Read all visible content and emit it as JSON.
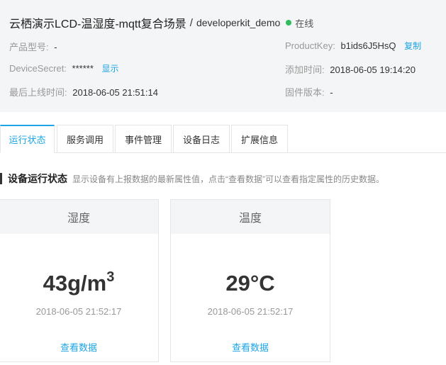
{
  "device": {
    "title": "云栖演示LCD-温湿度-mqtt复合场景",
    "separator": "/",
    "name": "developerkit_demo",
    "status": "在线",
    "status_color": "#2fbd5c"
  },
  "info": {
    "model_label": "产品型号:",
    "model_value": "-",
    "secret_label": "DeviceSecret:",
    "secret_value": "******",
    "secret_action": "显示",
    "last_online_label": "最后上线时间:",
    "last_online_value": "2018-06-05 21:51:14",
    "product_key_label": "ProductKey:",
    "product_key_value": "b1ids6J5HsQ",
    "product_key_action": "复制",
    "added_label": "添加时间:",
    "added_value": "2018-06-05 19:14:20",
    "firmware_label": "固件版本:",
    "firmware_value": "-"
  },
  "tabs": [
    {
      "label": "运行状态",
      "active": true
    },
    {
      "label": "服务调用",
      "active": false
    },
    {
      "label": "事件管理",
      "active": false
    },
    {
      "label": "设备日志",
      "active": false
    },
    {
      "label": "扩展信息",
      "active": false
    }
  ],
  "section": {
    "title": "设备运行状态",
    "description": "显示设备有上报数据的最新属性值，点击“查看数据”可以查看指定属性的历史数据。"
  },
  "cards": [
    {
      "name": "湿度",
      "value": "43g/m",
      "value_sup": "3",
      "time": "2018-06-05 21:52:17",
      "link": "查看数据"
    },
    {
      "name": "温度",
      "value": "29°C",
      "value_sup": "",
      "time": "2018-06-05 21:52:17",
      "link": "查看数据"
    }
  ],
  "colors": {
    "accent": "#1da5e6",
    "online": "#2fbd5c"
  }
}
